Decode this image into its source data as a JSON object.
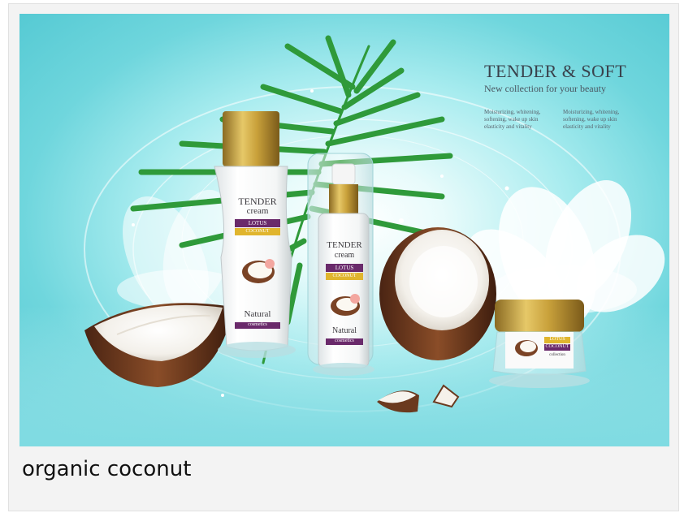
{
  "caption": "organic coconut",
  "headline": {
    "title": "TENDER & SOFT",
    "subtitle": "New collection for your beauty"
  },
  "blurbs": [
    "Moisturizing, whitening, softening, wake up skin elasticity and vitality",
    "Moisturizing, whitening, softening, wake up skin elasticity and vitality"
  ],
  "products": {
    "tall_bottle": {
      "brand": "TENDER",
      "type": "cream",
      "line1": "LOTUS",
      "line2": "COCONUT",
      "footer": "Natural",
      "footer_sub": "cosmetics"
    },
    "pump_bottle": {
      "brand": "TENDER",
      "type": "cream",
      "line1": "LOTUS",
      "line2": "COCONUT",
      "footer": "Natural",
      "footer_sub": "cosmetics"
    },
    "jar": {
      "line1": "LOTUS",
      "line2": "COCONUT",
      "footer_sub": "collection"
    }
  },
  "colors": {
    "background": "#6fd6dd",
    "gold_cap": "#c9a13b",
    "palm": "#2f9a3a",
    "coconut_shell": "#6b3a1f",
    "label_purple": "#6a2a6b"
  }
}
